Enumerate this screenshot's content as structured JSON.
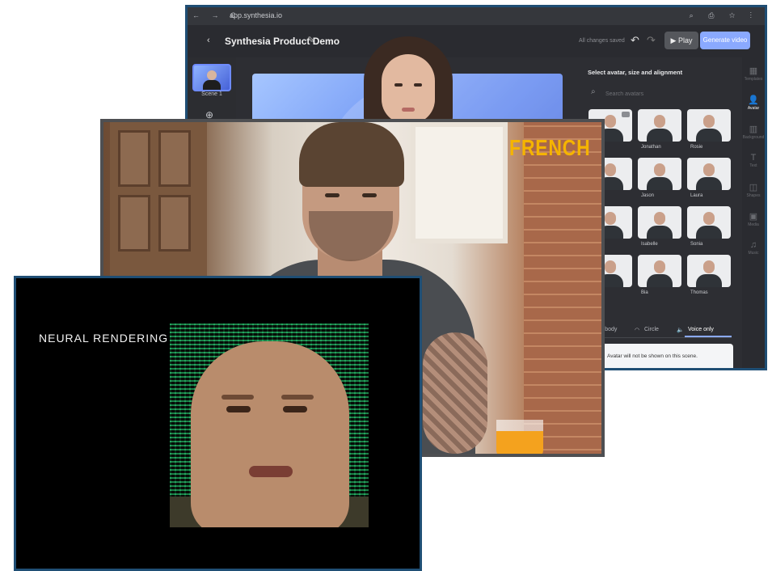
{
  "synthesia": {
    "browser": {
      "nav": "← → C",
      "url": "app.synthesia.io",
      "right_icons": "⌕ ⎙ ☆ ⋮"
    },
    "header": {
      "back": "‹",
      "title": "Synthesia Product Demo",
      "edit_icon": "pencil-icon",
      "status": "All changes saved",
      "undo": "↶",
      "redo": "↷",
      "play_label": "▶ Play",
      "generate_label": "Generate video"
    },
    "scenes": [
      {
        "label": "Scene 1"
      }
    ],
    "add_scene": "⊕",
    "avatar_panel": {
      "title": "Select avatar, size and alignment",
      "search_placeholder": "Search avatars",
      "avatars": [
        {
          "name": ""
        },
        {
          "name": "Jonathan"
        },
        {
          "name": "Rosie"
        },
        {
          "name": ""
        },
        {
          "name": "Jason"
        },
        {
          "name": "Laura"
        },
        {
          "name": ""
        },
        {
          "name": "Isabelle"
        },
        {
          "name": "Sonia"
        },
        {
          "name": ""
        },
        {
          "name": "Bia"
        },
        {
          "name": "Thomas"
        }
      ],
      "tabs": [
        "Full body",
        "Circle",
        "Voice only"
      ],
      "active_tab": "Voice only",
      "note": "Avatar will not be shown on this scene."
    },
    "rail": [
      {
        "icon": "▦",
        "label": "Templates"
      },
      {
        "icon": "👤",
        "label": "Avatar"
      },
      {
        "icon": "▥",
        "label": "Background"
      },
      {
        "icon": "T",
        "label": "Text"
      },
      {
        "icon": "◫",
        "label": "Shapes"
      },
      {
        "icon": "▣",
        "label": "Media"
      },
      {
        "icon": "♫",
        "label": "Music"
      }
    ]
  },
  "french_video": {
    "caption": "FRENCH"
  },
  "neural": {
    "label": "NEURAL RENDERING"
  }
}
